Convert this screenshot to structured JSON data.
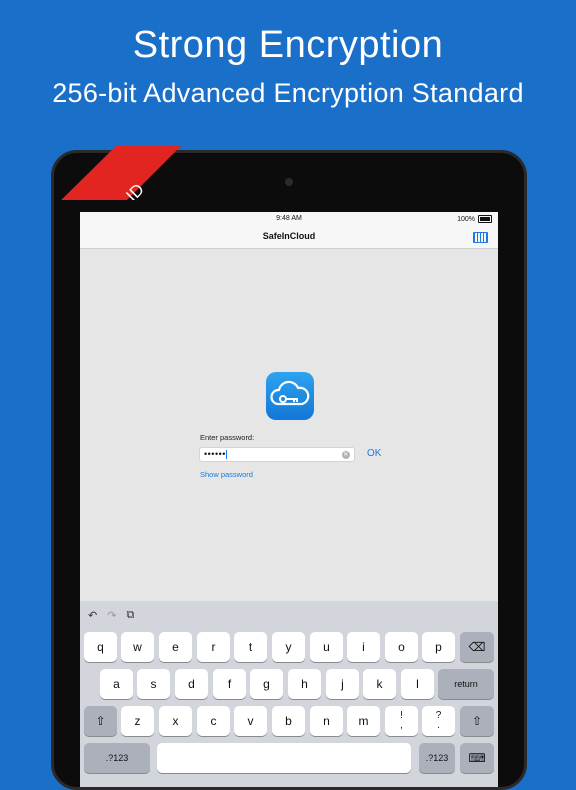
{
  "marketing": {
    "headline": "Strong Encryption",
    "subheadline": "256-bit Advanced Encryption Standard"
  },
  "badge": {
    "label": "Touch ID",
    "icon": "fingerprint-icon",
    "color": "#e22520"
  },
  "statusbar": {
    "time": "9:48 AM",
    "battery": "100%"
  },
  "navbar": {
    "title": "SafeInCloud",
    "keyboard_icon": "keyboard-icon"
  },
  "app": {
    "icon": "cloud-key-icon"
  },
  "login": {
    "label": "Enter password:",
    "value": "••••••",
    "ok_label": "OK",
    "show_password_label": "Show password"
  },
  "keyboard": {
    "row1": [
      "q",
      "w",
      "e",
      "r",
      "t",
      "y",
      "u",
      "i",
      "o",
      "p"
    ],
    "row2": [
      "a",
      "s",
      "d",
      "f",
      "g",
      "h",
      "j",
      "k",
      "l"
    ],
    "row3": [
      "z",
      "x",
      "c",
      "v",
      "b",
      "n",
      "m"
    ],
    "return_label": "return",
    "numbers_label": ".?123",
    "punct": [
      {
        "top": "!",
        "bottom": ","
      },
      {
        "top": "?",
        "bottom": "."
      }
    ]
  },
  "colors": {
    "background": "#1a6fc9",
    "accent": "#1a7be0"
  }
}
